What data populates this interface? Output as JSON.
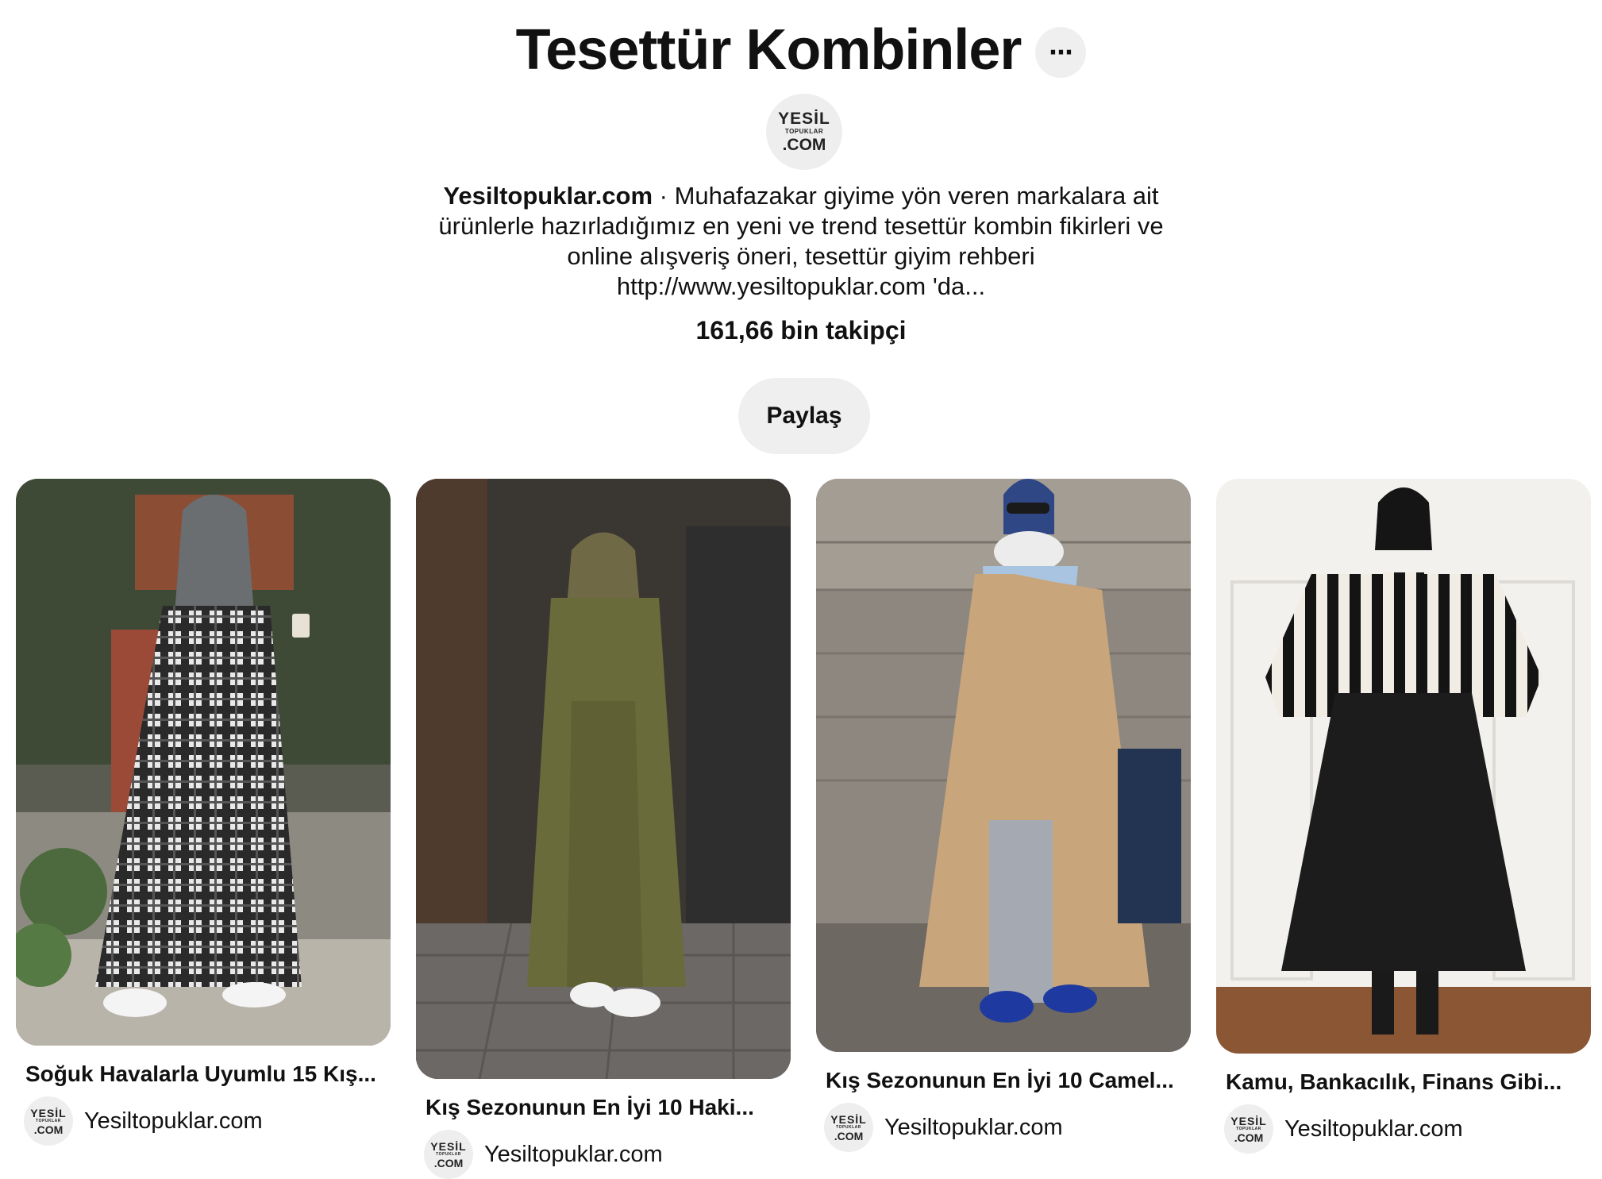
{
  "board": {
    "title": "Tesettür Kombinler",
    "more_label": "⋯",
    "owner": "Yesiltopuklar.com",
    "description_separator": " · ",
    "description": "Muhafazakar giyime yön veren markalara ait ürünlerle hazırladığımız en yeni ve trend tesettür kombin fikirleri ve online alışveriş öneri, tesettür giyim rehberi http://www.yesiltopuklar.com 'da...",
    "followers": "161,66 bin takipçi",
    "share_label": "Paylaş",
    "logo": {
      "line1": "YESİL",
      "line2": "TOPUKLAR",
      "line3": ".COM"
    }
  },
  "pins": [
    {
      "title": "Soğuk Havalarla Uyumlu 15 Kış...",
      "source": "Yesiltopuklar.com",
      "palette": "plaid"
    },
    {
      "title": "Kış Sezonunun En İyi 10 Haki...",
      "source": "Yesiltopuklar.com",
      "palette": "khaki"
    },
    {
      "title": "Kış Sezonunun En İyi 10 Camel...",
      "source": "Yesiltopuklar.com",
      "palette": "camel"
    },
    {
      "title": "Kamu, Bankacılık, Finans Gibi...",
      "source": "Yesiltopuklar.com",
      "palette": "stripes"
    }
  ],
  "colors": {
    "button_bg": "#efefef",
    "text": "#111111",
    "background": "#ffffff"
  }
}
